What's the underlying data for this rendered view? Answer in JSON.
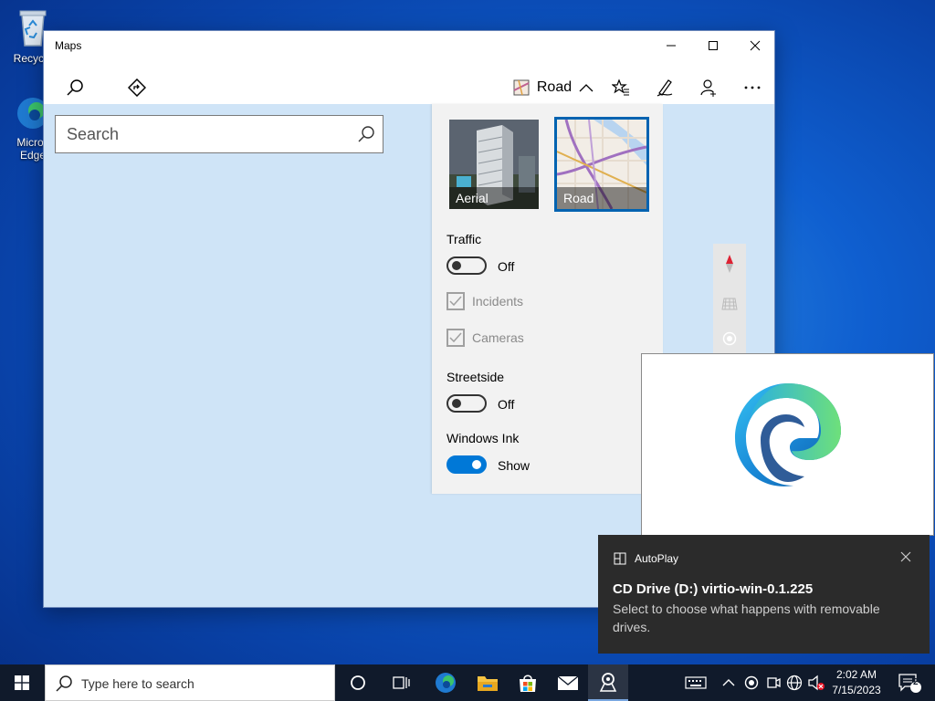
{
  "desktop": {
    "icons": [
      {
        "label": "Recycle",
        "icon": "recycle-bin-icon"
      },
      {
        "label": "Micros Edge",
        "icon": "edge-icon"
      }
    ]
  },
  "window": {
    "title": "Maps",
    "controls": {
      "minimize": "minimize-icon",
      "maximize": "maximize-icon",
      "close": "close-icon"
    }
  },
  "toolbar": {
    "tabs": [
      {
        "name": "search",
        "icon": "search-icon",
        "active": true
      },
      {
        "name": "directions",
        "icon": "directions-icon",
        "active": false
      }
    ],
    "map_style_label": "Road",
    "buttons": [
      "favorites-icon",
      "ink-pen-icon",
      "account-icon",
      "more-icon"
    ]
  },
  "search": {
    "placeholder": "Search",
    "value": ""
  },
  "map_style_panel": {
    "styles": [
      {
        "label": "Aerial",
        "selected": false
      },
      {
        "label": "Road",
        "selected": true
      }
    ],
    "traffic": {
      "label": "Traffic",
      "toggle_state": "Off",
      "on": false
    },
    "incidents": {
      "label": "Incidents",
      "checked": true
    },
    "cameras": {
      "label": "Cameras",
      "checked": true
    },
    "streetside": {
      "label": "Streetside",
      "toggle_state": "Off",
      "on": false
    },
    "windows_ink": {
      "label": "Windows Ink",
      "toggle_state": "Show",
      "on": true
    }
  },
  "map_controls": [
    "compass-icon",
    "3d-view-icon",
    "my-location-icon"
  ],
  "toast": {
    "app": "AutoPlay",
    "headline": "CD Drive (D:) virtio-win-0.1.225",
    "body": "Select to choose what happens with removable drives."
  },
  "taskbar": {
    "search_placeholder": "Type here to search",
    "pinned": [
      "cortana-icon",
      "task-view-icon",
      "edge-icon",
      "file-explorer-icon",
      "store-icon",
      "mail-icon",
      "maps-icon"
    ],
    "tray": [
      "keyboard-icon",
      "chevron-up-icon",
      "record-icon",
      "webcam-icon",
      "network-icon",
      "volume-muted-icon"
    ],
    "time": "2:02 AM",
    "date": "7/15/2023",
    "notifications_count": "2"
  },
  "colors": {
    "accent": "#0078d7",
    "map_background": "#cfe4f7",
    "toast_bg": "#2b2b2b",
    "taskbar_bg": "#101a2b"
  }
}
